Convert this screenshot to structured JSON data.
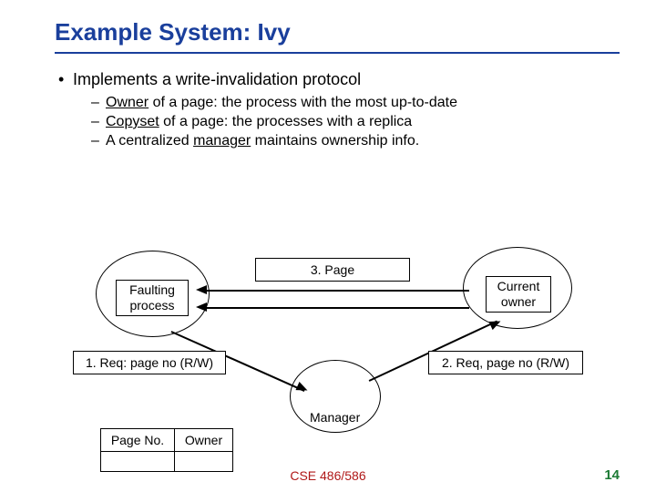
{
  "title": "Example System: Ivy",
  "bullet_main": "Implements a write-invalidation protocol",
  "sub1_pre": "",
  "sub1_u": "Owner",
  "sub1_post": " of a page: the process with the most up-to-date",
  "sub2_pre": "",
  "sub2_u": "Copyset",
  "sub2_post": " of a page: the processes with a replica",
  "sub3_pre": "A centralized ",
  "sub3_u": "manager",
  "sub3_post": " maintains ownership info.",
  "diagram": {
    "faulting": "Faulting\nprocess",
    "current": "Current\nowner",
    "page_msg": "3. Page",
    "req1": "1. Req: page no (R/W)",
    "req2": "2. Req, page no (R/W)",
    "manager": "Manager",
    "table_h1": "Page No.",
    "table_h2": "Owner"
  },
  "footer_center": "CSE 486/586",
  "footer_right": "14"
}
